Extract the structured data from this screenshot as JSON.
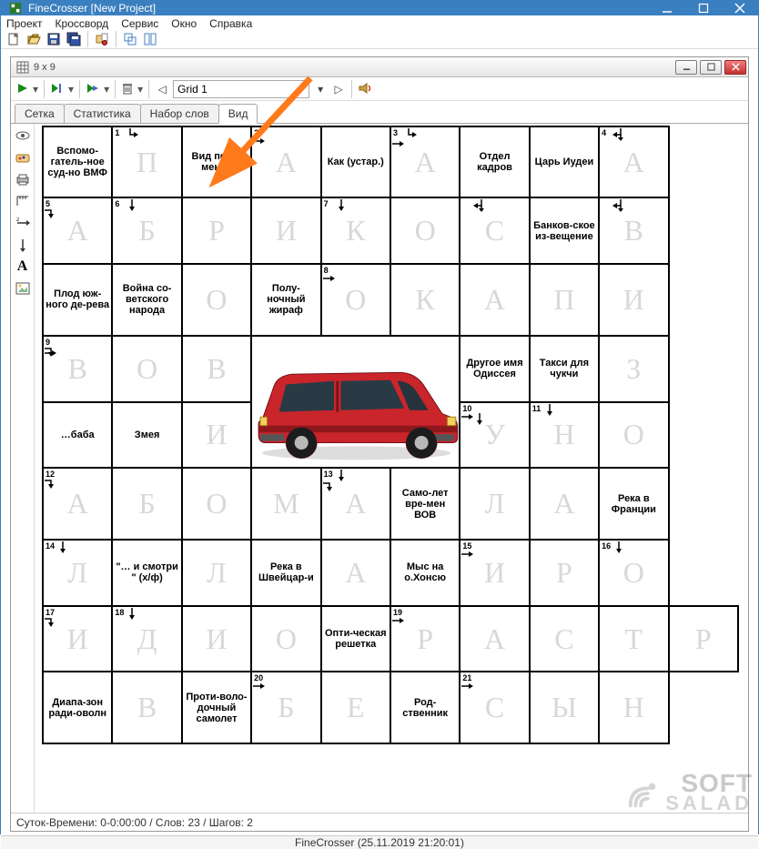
{
  "app": {
    "title": "FineCrosser [New Project]",
    "status": "FineCrosser (25.11.2019 21:20:01)"
  },
  "menu": {
    "items": [
      "Проект",
      "Кроссворд",
      "Сервис",
      "Окно",
      "Справка"
    ]
  },
  "mdi": {
    "title": "9 x 9",
    "grid_input": "Grid 1",
    "tabs": [
      "Сетка",
      "Статистика",
      "Набор слов",
      "Вид"
    ],
    "active_tab": 3,
    "status": "Суток-Времени: 0-0:00:00 / Слов: 23 / Шагов: 2"
  },
  "watermark": {
    "line1": "SOFT",
    "line2": "SALAD"
  },
  "grid": {
    "rows": [
      [
        {
          "clue": "Вспомо-гатель-ное суд-но ВМФ"
        },
        {
          "num": "1",
          "letter": "П",
          "arrows": [
            "dr"
          ]
        },
        {
          "clue": "Вид пель-меней"
        },
        {
          "num": "2",
          "letter": "А",
          "arrows": [
            "r"
          ]
        },
        {
          "clue": "Как (устар.)"
        },
        {
          "num": "3",
          "letter": "А",
          "arrows": [
            "dr",
            "r"
          ]
        },
        {
          "clue": "Отдел кадров"
        },
        {
          "clue": "Царь Иудеи"
        },
        {
          "num": "4",
          "letter": "А",
          "arrows": [
            "dl"
          ]
        }
      ],
      [
        {
          "num": "5",
          "letter": "А",
          "arrows": [
            "rd"
          ]
        },
        {
          "num": "6",
          "letter": "Б",
          "arrows": [
            "d"
          ]
        },
        {
          "letter": "Р"
        },
        {
          "letter": "И"
        },
        {
          "num": "7",
          "letter": "К",
          "arrows": [
            "d"
          ]
        },
        {
          "letter": "О"
        },
        {
          "letter": "С",
          "arrows": [
            "dl"
          ]
        },
        {
          "clue": "Банков-ское из-вещение"
        },
        {
          "letter": "В",
          "arrows": [
            "dl"
          ]
        }
      ],
      [
        {
          "clue": "Плод юж-ного де-рева"
        },
        {
          "clue": "Война со-ветского народа"
        },
        {
          "letter": "О"
        },
        {
          "clue": "Полу-ночный жираф"
        },
        {
          "num": "8",
          "letter": "О",
          "arrows": [
            "r"
          ]
        },
        {
          "letter": "К"
        },
        {
          "letter": "А"
        },
        {
          "letter": "П"
        },
        {
          "letter": "И"
        }
      ],
      [
        {
          "num": "9",
          "letter": "В",
          "arrows": [
            "rd",
            "r"
          ]
        },
        {
          "letter": "О"
        },
        {
          "letter": "В"
        },
        {
          "car": true,
          "colspan": 3,
          "rowspan": 2
        },
        {
          "clue": "Другое имя Одиссея"
        },
        {
          "clue": "Такси для чукчи"
        },
        {
          "letter": "З"
        }
      ],
      [
        {
          "clue": "…баба"
        },
        {
          "clue": "Змея"
        },
        {
          "letter": "И"
        },
        {
          "num": "10",
          "letter": "У",
          "arrows": [
            "r",
            "d"
          ]
        },
        {
          "num": "11",
          "letter": "Н",
          "arrows": [
            "d"
          ]
        },
        {
          "letter": "О"
        }
      ],
      [
        {
          "num": "12",
          "letter": "А",
          "arrows": [
            "rd"
          ]
        },
        {
          "letter": "Б"
        },
        {
          "letter": "О"
        },
        {
          "letter": "М"
        },
        {
          "num": "13",
          "letter": "А",
          "arrows": [
            "d",
            "rd"
          ]
        },
        {
          "clue": "Само-лет вре-мен ВОВ"
        },
        {
          "letter": "Л"
        },
        {
          "letter": "А"
        },
        {
          "clue": "Река в Франции"
        }
      ],
      [
        {
          "num": "14",
          "letter": "Л",
          "arrows": [
            "d"
          ]
        },
        {
          "clue": "\"… и смотри \" (х/ф)"
        },
        {
          "letter": "Л"
        },
        {
          "clue": "Река в Швейцар-и"
        },
        {
          "letter": "А"
        },
        {
          "clue": "Мыс на о.Хонсю"
        },
        {
          "num": "15",
          "letter": "И",
          "arrows": [
            "r"
          ]
        },
        {
          "letter": "Р"
        },
        {
          "num": "16",
          "letter": "О",
          "arrows": [
            "d"
          ]
        }
      ],
      [
        {
          "num": "17",
          "letter": "И",
          "arrows": [
            "rd"
          ]
        },
        {
          "num": "18",
          "letter": "Д",
          "arrows": [
            "d"
          ]
        },
        {
          "letter": "И"
        },
        {
          "letter": "О"
        },
        {
          "clue": "Опти-ческая решетка"
        },
        {
          "num": "19",
          "letter": "Р",
          "arrows": [
            "r"
          ]
        },
        {
          "letter": "А"
        },
        {
          "letter": "С"
        },
        {
          "letter": "Т"
        },
        {
          "letter": "Р"
        }
      ],
      [
        {
          "clue": "Диапа-зон ради-оволн"
        },
        {
          "letter": "В"
        },
        {
          "clue": "Проти-воло-дочный самолет"
        },
        {
          "num": "20",
          "letter": "Б",
          "arrows": [
            "r"
          ]
        },
        {
          "letter": "Е"
        },
        {
          "clue": "Род-ственник"
        },
        {
          "num": "21",
          "letter": "С",
          "arrows": [
            "r"
          ]
        },
        {
          "letter": "Ы"
        },
        {
          "letter": "Н"
        }
      ]
    ]
  }
}
